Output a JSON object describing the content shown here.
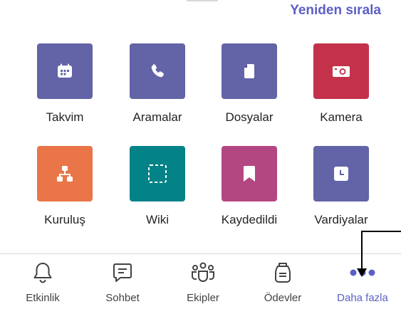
{
  "header": {
    "reorder_label": "Yeniden sırala"
  },
  "apps": [
    {
      "label": "Takvim",
      "icon": "calendar-icon",
      "color": "#6264a7"
    },
    {
      "label": "Aramalar",
      "icon": "phone-icon",
      "color": "#6264a7"
    },
    {
      "label": "Dosyalar",
      "icon": "file-icon",
      "color": "#6264a7"
    },
    {
      "label": "Kamera",
      "icon": "camera-icon",
      "color": "#c4314b"
    },
    {
      "label": "Kuruluş",
      "icon": "org-chart-icon",
      "color": "#e97548"
    },
    {
      "label": "Wiki",
      "icon": "wiki-icon",
      "color": "#038387"
    },
    {
      "label": "Kaydedildi",
      "icon": "bookmark-icon",
      "color": "#b24782"
    },
    {
      "label": "Vardiyalar",
      "icon": "shifts-clock-icon",
      "color": "#6264a7"
    }
  ],
  "tabs": [
    {
      "label": "Etkinlik",
      "icon": "bell-icon"
    },
    {
      "label": "Sohbet",
      "icon": "chat-icon"
    },
    {
      "label": "Ekipler",
      "icon": "teams-icon"
    },
    {
      "label": "Ödevler",
      "icon": "assignments-icon"
    },
    {
      "label": "Daha fazla",
      "icon": "more-dots-icon",
      "active": true
    }
  ],
  "colors": {
    "accent": "#5b5fc7",
    "text": "#252424"
  }
}
